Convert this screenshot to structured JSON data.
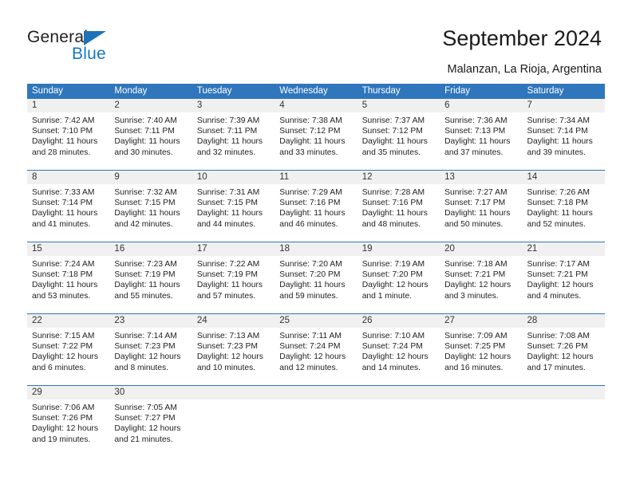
{
  "brand": {
    "name_top": "General",
    "name_bottom": "Blue",
    "accent_color": "#1577c4"
  },
  "header": {
    "title": "September 2024",
    "subtitle": "Malanzan, La Rioja, Argentina"
  },
  "colors": {
    "header_blue": "#2f76bc",
    "daynum_band": "#f0f0f0",
    "text": "#1f1f1f"
  },
  "weekday_headers": [
    "Sunday",
    "Monday",
    "Tuesday",
    "Wednesday",
    "Thursday",
    "Friday",
    "Saturday"
  ],
  "weeks": [
    [
      {
        "day": "1",
        "sunrise": "Sunrise: 7:42 AM",
        "sunset": "Sunset: 7:10 PM",
        "daylight1": "Daylight: 11 hours",
        "daylight2": "and 28 minutes."
      },
      {
        "day": "2",
        "sunrise": "Sunrise: 7:40 AM",
        "sunset": "Sunset: 7:11 PM",
        "daylight1": "Daylight: 11 hours",
        "daylight2": "and 30 minutes."
      },
      {
        "day": "3",
        "sunrise": "Sunrise: 7:39 AM",
        "sunset": "Sunset: 7:11 PM",
        "daylight1": "Daylight: 11 hours",
        "daylight2": "and 32 minutes."
      },
      {
        "day": "4",
        "sunrise": "Sunrise: 7:38 AM",
        "sunset": "Sunset: 7:12 PM",
        "daylight1": "Daylight: 11 hours",
        "daylight2": "and 33 minutes."
      },
      {
        "day": "5",
        "sunrise": "Sunrise: 7:37 AM",
        "sunset": "Sunset: 7:12 PM",
        "daylight1": "Daylight: 11 hours",
        "daylight2": "and 35 minutes."
      },
      {
        "day": "6",
        "sunrise": "Sunrise: 7:36 AM",
        "sunset": "Sunset: 7:13 PM",
        "daylight1": "Daylight: 11 hours",
        "daylight2": "and 37 minutes."
      },
      {
        "day": "7",
        "sunrise": "Sunrise: 7:34 AM",
        "sunset": "Sunset: 7:14 PM",
        "daylight1": "Daylight: 11 hours",
        "daylight2": "and 39 minutes."
      }
    ],
    [
      {
        "day": "8",
        "sunrise": "Sunrise: 7:33 AM",
        "sunset": "Sunset: 7:14 PM",
        "daylight1": "Daylight: 11 hours",
        "daylight2": "and 41 minutes."
      },
      {
        "day": "9",
        "sunrise": "Sunrise: 7:32 AM",
        "sunset": "Sunset: 7:15 PM",
        "daylight1": "Daylight: 11 hours",
        "daylight2": "and 42 minutes."
      },
      {
        "day": "10",
        "sunrise": "Sunrise: 7:31 AM",
        "sunset": "Sunset: 7:15 PM",
        "daylight1": "Daylight: 11 hours",
        "daylight2": "and 44 minutes."
      },
      {
        "day": "11",
        "sunrise": "Sunrise: 7:29 AM",
        "sunset": "Sunset: 7:16 PM",
        "daylight1": "Daylight: 11 hours",
        "daylight2": "and 46 minutes."
      },
      {
        "day": "12",
        "sunrise": "Sunrise: 7:28 AM",
        "sunset": "Sunset: 7:16 PM",
        "daylight1": "Daylight: 11 hours",
        "daylight2": "and 48 minutes."
      },
      {
        "day": "13",
        "sunrise": "Sunrise: 7:27 AM",
        "sunset": "Sunset: 7:17 PM",
        "daylight1": "Daylight: 11 hours",
        "daylight2": "and 50 minutes."
      },
      {
        "day": "14",
        "sunrise": "Sunrise: 7:26 AM",
        "sunset": "Sunset: 7:18 PM",
        "daylight1": "Daylight: 11 hours",
        "daylight2": "and 52 minutes."
      }
    ],
    [
      {
        "day": "15",
        "sunrise": "Sunrise: 7:24 AM",
        "sunset": "Sunset: 7:18 PM",
        "daylight1": "Daylight: 11 hours",
        "daylight2": "and 53 minutes."
      },
      {
        "day": "16",
        "sunrise": "Sunrise: 7:23 AM",
        "sunset": "Sunset: 7:19 PM",
        "daylight1": "Daylight: 11 hours",
        "daylight2": "and 55 minutes."
      },
      {
        "day": "17",
        "sunrise": "Sunrise: 7:22 AM",
        "sunset": "Sunset: 7:19 PM",
        "daylight1": "Daylight: 11 hours",
        "daylight2": "and 57 minutes."
      },
      {
        "day": "18",
        "sunrise": "Sunrise: 7:20 AM",
        "sunset": "Sunset: 7:20 PM",
        "daylight1": "Daylight: 11 hours",
        "daylight2": "and 59 minutes."
      },
      {
        "day": "19",
        "sunrise": "Sunrise: 7:19 AM",
        "sunset": "Sunset: 7:20 PM",
        "daylight1": "Daylight: 12 hours",
        "daylight2": "and 1 minute."
      },
      {
        "day": "20",
        "sunrise": "Sunrise: 7:18 AM",
        "sunset": "Sunset: 7:21 PM",
        "daylight1": "Daylight: 12 hours",
        "daylight2": "and 3 minutes."
      },
      {
        "day": "21",
        "sunrise": "Sunrise: 7:17 AM",
        "sunset": "Sunset: 7:21 PM",
        "daylight1": "Daylight: 12 hours",
        "daylight2": "and 4 minutes."
      }
    ],
    [
      {
        "day": "22",
        "sunrise": "Sunrise: 7:15 AM",
        "sunset": "Sunset: 7:22 PM",
        "daylight1": "Daylight: 12 hours",
        "daylight2": "and 6 minutes."
      },
      {
        "day": "23",
        "sunrise": "Sunrise: 7:14 AM",
        "sunset": "Sunset: 7:23 PM",
        "daylight1": "Daylight: 12 hours",
        "daylight2": "and 8 minutes."
      },
      {
        "day": "24",
        "sunrise": "Sunrise: 7:13 AM",
        "sunset": "Sunset: 7:23 PM",
        "daylight1": "Daylight: 12 hours",
        "daylight2": "and 10 minutes."
      },
      {
        "day": "25",
        "sunrise": "Sunrise: 7:11 AM",
        "sunset": "Sunset: 7:24 PM",
        "daylight1": "Daylight: 12 hours",
        "daylight2": "and 12 minutes."
      },
      {
        "day": "26",
        "sunrise": "Sunrise: 7:10 AM",
        "sunset": "Sunset: 7:24 PM",
        "daylight1": "Daylight: 12 hours",
        "daylight2": "and 14 minutes."
      },
      {
        "day": "27",
        "sunrise": "Sunrise: 7:09 AM",
        "sunset": "Sunset: 7:25 PM",
        "daylight1": "Daylight: 12 hours",
        "daylight2": "and 16 minutes."
      },
      {
        "day": "28",
        "sunrise": "Sunrise: 7:08 AM",
        "sunset": "Sunset: 7:26 PM",
        "daylight1": "Daylight: 12 hours",
        "daylight2": "and 17 minutes."
      }
    ],
    [
      {
        "day": "29",
        "sunrise": "Sunrise: 7:06 AM",
        "sunset": "Sunset: 7:26 PM",
        "daylight1": "Daylight: 12 hours",
        "daylight2": "and 19 minutes."
      },
      {
        "day": "30",
        "sunrise": "Sunrise: 7:05 AM",
        "sunset": "Sunset: 7:27 PM",
        "daylight1": "Daylight: 12 hours",
        "daylight2": "and 21 minutes."
      },
      {
        "day": "",
        "sunrise": "",
        "sunset": "",
        "daylight1": "",
        "daylight2": ""
      },
      {
        "day": "",
        "sunrise": "",
        "sunset": "",
        "daylight1": "",
        "daylight2": ""
      },
      {
        "day": "",
        "sunrise": "",
        "sunset": "",
        "daylight1": "",
        "daylight2": ""
      },
      {
        "day": "",
        "sunrise": "",
        "sunset": "",
        "daylight1": "",
        "daylight2": ""
      },
      {
        "day": "",
        "sunrise": "",
        "sunset": "",
        "daylight1": "",
        "daylight2": ""
      }
    ]
  ]
}
